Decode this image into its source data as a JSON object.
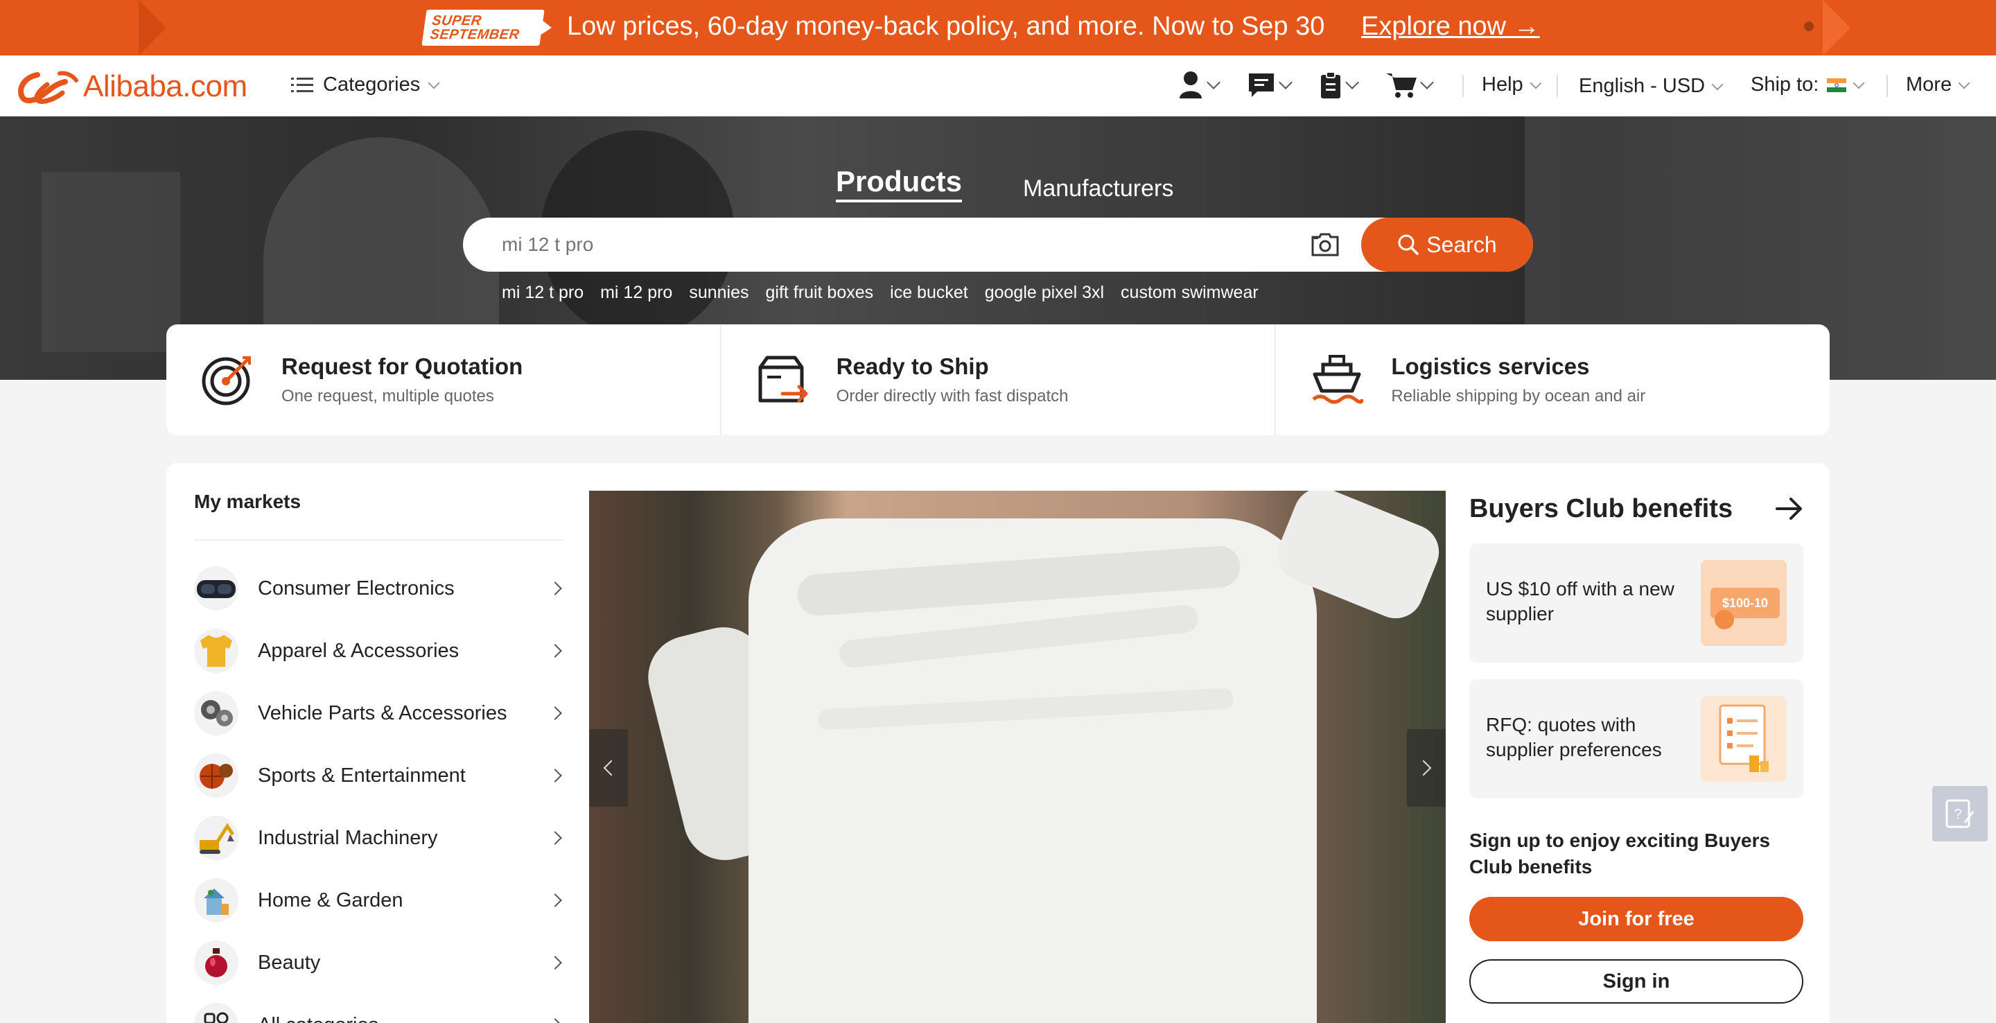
{
  "promo": {
    "badge_line1": "SUPER",
    "badge_line2": "SEPTEMBER",
    "message": "Low prices, 60-day money-back policy, and more. Now to Sep 30",
    "cta": "Explore now →"
  },
  "header": {
    "logo_text": "Alibaba.com",
    "categories_label": "Categories",
    "help_label": "Help",
    "language_label": "English - USD",
    "ship_to_label": "Ship to:",
    "more_label": "More"
  },
  "hero": {
    "tabs": [
      {
        "label": "Products",
        "active": true
      },
      {
        "label": "Manufacturers",
        "active": false
      }
    ],
    "search_placeholder": "mi 12 t pro",
    "search_button": "Search",
    "suggestions": [
      "mi 12 t pro",
      "mi 12 pro",
      "sunnies",
      "gift fruit boxes",
      "ice bucket",
      "google pixel 3xl",
      "custom swimwear"
    ]
  },
  "services": [
    {
      "title": "Request for Quotation",
      "subtitle": "One request, multiple quotes",
      "icon": "target-icon"
    },
    {
      "title": "Ready to Ship",
      "subtitle": "Order directly with fast dispatch",
      "icon": "box-ship-icon"
    },
    {
      "title": "Logistics services",
      "subtitle": "Reliable shipping by ocean and air",
      "icon": "cargo-ship-icon"
    }
  ],
  "markets": {
    "title": "My markets",
    "items": [
      {
        "label": "Consumer Electronics",
        "icon": "vr-headset-icon"
      },
      {
        "label": "Apparel & Accessories",
        "icon": "tshirt-icon"
      },
      {
        "label": "Vehicle Parts & Accessories",
        "icon": "car-parts-icon"
      },
      {
        "label": "Sports & Entertainment",
        "icon": "sports-balls-icon"
      },
      {
        "label": "Industrial Machinery",
        "icon": "excavator-icon"
      },
      {
        "label": "Home & Garden",
        "icon": "home-garden-icon"
      },
      {
        "label": "Beauty",
        "icon": "perfume-icon"
      },
      {
        "label": "All categories",
        "icon": "grid-icon"
      }
    ]
  },
  "club": {
    "title": "Buyers Club benefits",
    "benefits": [
      {
        "text": "US $10 off with a new supplier",
        "img_label": "$100-10"
      },
      {
        "text": "RFQ: quotes with supplier preferences"
      }
    ],
    "signup_text": "Sign up to enjoy exciting Buyers Club benefits",
    "join_button": "Join for free",
    "signin_button": "Sign in"
  },
  "colors": {
    "brand": "#e4561a",
    "text": "#222222",
    "muted": "#666666"
  }
}
